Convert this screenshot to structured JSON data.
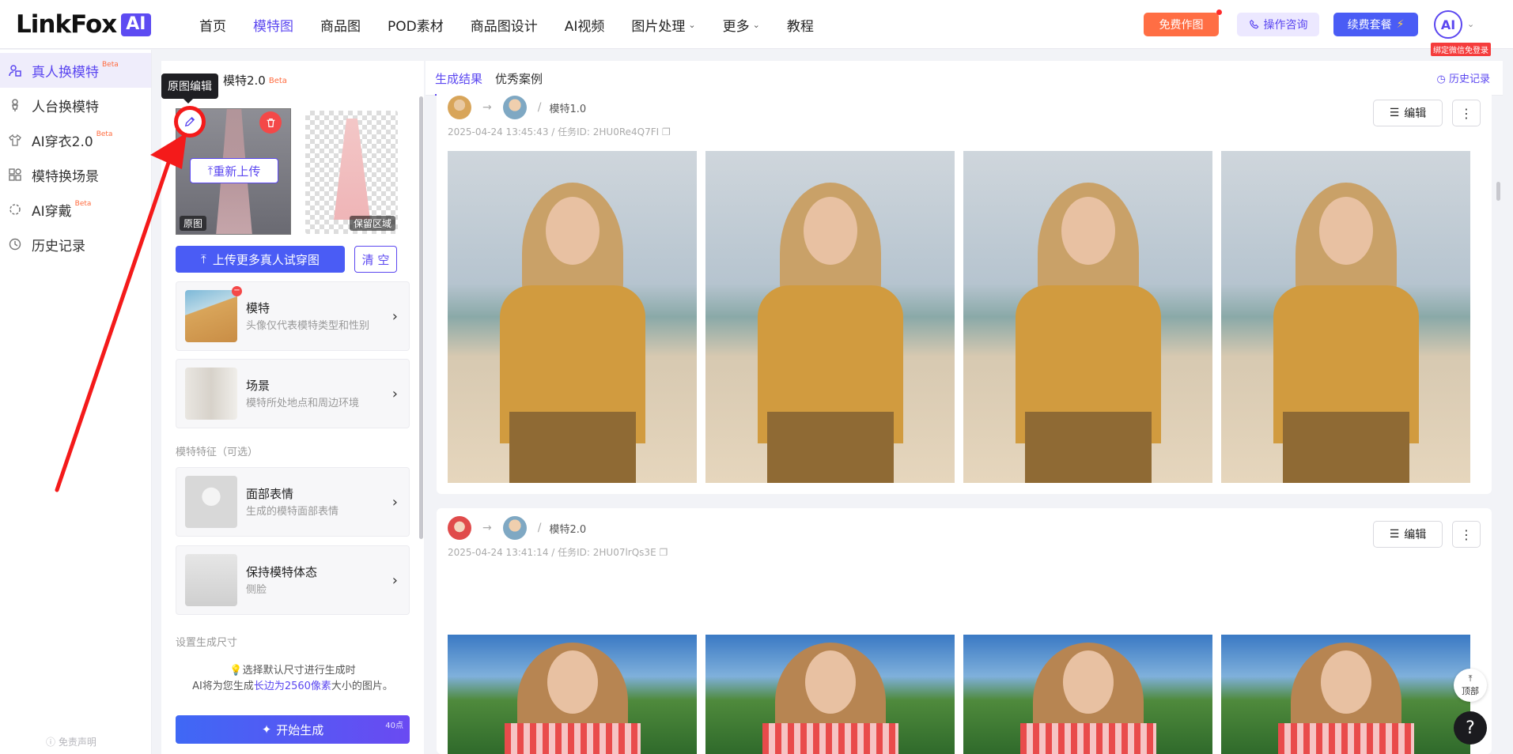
{
  "header": {
    "logo_text": "LinkFox",
    "logo_badge": "AI",
    "nav": [
      {
        "label": "首页",
        "active": false,
        "caret": false
      },
      {
        "label": "模特图",
        "active": true,
        "caret": false
      },
      {
        "label": "商品图",
        "active": false,
        "caret": false
      },
      {
        "label": "POD素材",
        "active": false,
        "caret": false
      },
      {
        "label": "商品图设计",
        "active": false,
        "caret": false
      },
      {
        "label": "AI视频",
        "active": false,
        "caret": false
      },
      {
        "label": "图片处理",
        "active": false,
        "caret": true
      },
      {
        "label": "更多",
        "active": false,
        "caret": true
      },
      {
        "label": "教程",
        "active": false,
        "caret": false
      }
    ],
    "free_btn": "免费作图",
    "consult_btn": "操作咨询",
    "renew_btn": "续费套餐",
    "avatar_text": "AI",
    "bind_tag": "绑定微信免登录"
  },
  "sidebar": {
    "items": [
      {
        "label": "真人换模特",
        "beta": "Beta",
        "active": true,
        "icon": "person-swap-icon"
      },
      {
        "label": "人台换模特",
        "beta": "",
        "active": false,
        "icon": "mannequin-icon"
      },
      {
        "label": "AI穿衣2.0",
        "beta": "Beta",
        "active": false,
        "icon": "shirt-icon"
      },
      {
        "label": "模特换场景",
        "beta": "",
        "active": false,
        "icon": "scene-icon"
      },
      {
        "label": "AI穿戴",
        "beta": "Beta",
        "active": false,
        "icon": "ring-icon"
      },
      {
        "label": "历史记录",
        "beta": "",
        "active": false,
        "icon": "history-icon"
      }
    ],
    "disclaimer": "免责声明"
  },
  "panel": {
    "title": "模特2.0",
    "title_beta": "Beta",
    "tooltip": "原图编辑",
    "reupload": "重新上传",
    "orig_tag": "原图",
    "keep_tag": "保留区域",
    "upload_more": "上传更多真人试穿图",
    "clear": "清 空",
    "model_card": {
      "title": "模特",
      "sub": "头像仅代表模特类型和性别"
    },
    "scene_card": {
      "title": "场景",
      "sub": "模特所处地点和周边环境"
    },
    "features_label": "模特特征（可选）",
    "face_card": {
      "title": "面部表情",
      "sub": "生成的模特面部表情"
    },
    "pose_card": {
      "title": "保持模特体态",
      "sub": "侧脸"
    },
    "size_label": "设置生成尺寸",
    "size_tip_1": "选择默认尺寸进行生成时",
    "size_tip_2a": "AI将为您生成",
    "size_tip_2b": "长边为2560像素",
    "size_tip_2c": "大小的图片。",
    "generate": "开始生成",
    "generate_cost": "40点"
  },
  "results": {
    "tab_result": "生成结果",
    "tab_cases": "优秀案例",
    "history": "历史记录",
    "edit_label": "编辑",
    "cards": [
      {
        "version": "模特1.0",
        "meta": "2025-04-24 13:45:43 / 任务ID: 2HU0Re4Q7FI"
      },
      {
        "version": "模特2.0",
        "meta": "2025-04-24 13:41:14 / 任务ID: 2HU07lrQs3E"
      }
    ]
  },
  "float": {
    "totop": "顶部",
    "help": "?"
  },
  "colors": {
    "accent": "#5b47f0",
    "primary_btn": "#4a5cf5",
    "orange": "#ff6e44",
    "annotation_red": "#f41a1a"
  }
}
